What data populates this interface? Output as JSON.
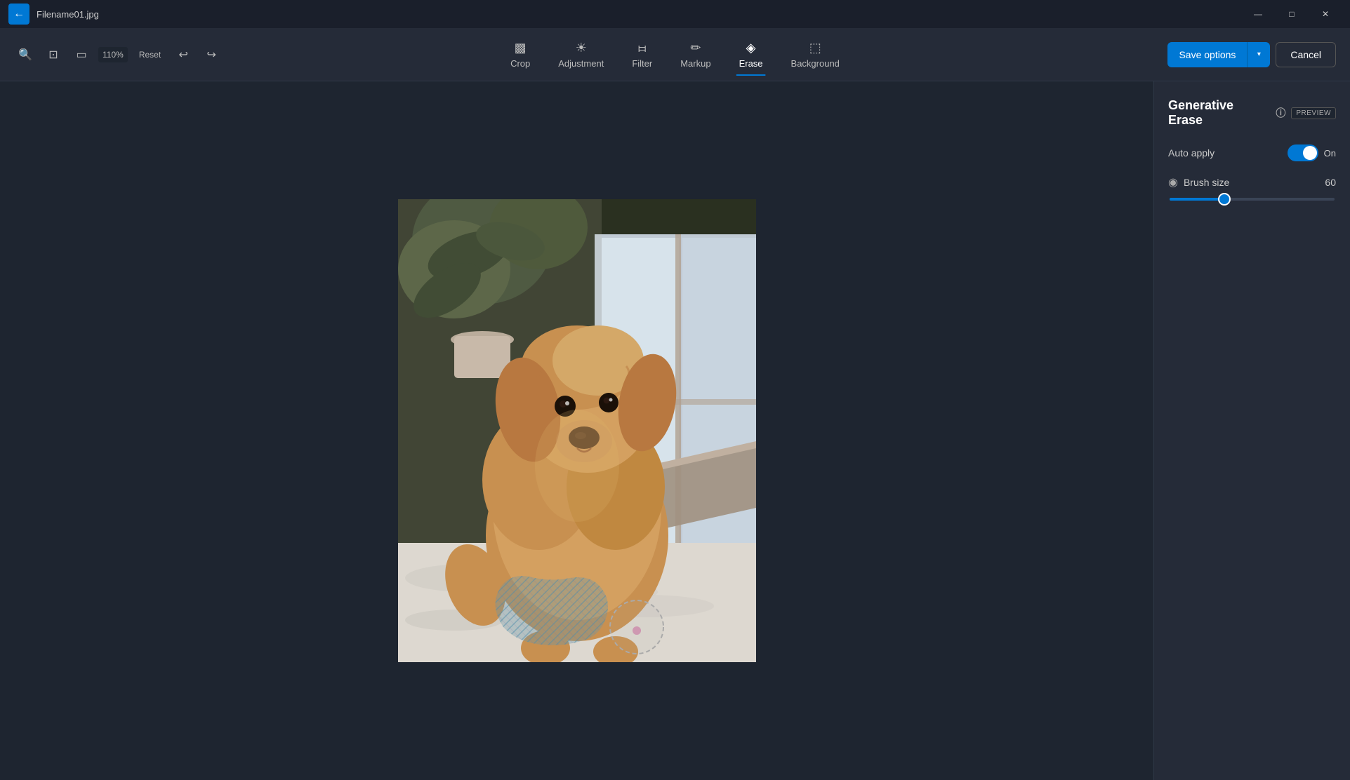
{
  "titlebar": {
    "filename": "Filename01.jpg",
    "minimize_label": "—",
    "maximize_label": "□",
    "close_label": "✕"
  },
  "toolbar": {
    "zoom_level": "110%",
    "reset_label": "Reset",
    "undo_icon": "↩",
    "redo_icon": "↪",
    "tools": [
      {
        "id": "crop",
        "label": "Crop",
        "icon": "⊡",
        "active": false
      },
      {
        "id": "adjustment",
        "label": "Adjustment",
        "icon": "☀",
        "active": false
      },
      {
        "id": "filter",
        "label": "Filter",
        "icon": "⧖",
        "active": false
      },
      {
        "id": "markup",
        "label": "Markup",
        "icon": "✏",
        "active": false
      },
      {
        "id": "erase",
        "label": "Erase",
        "icon": "◈",
        "active": true
      },
      {
        "id": "background",
        "label": "Background",
        "icon": "⬚",
        "active": false
      }
    ],
    "save_options_label": "Save options",
    "cancel_label": "Cancel"
  },
  "panel": {
    "title": "Generative Erase",
    "preview_badge": "PREVIEW",
    "info_tooltip": "Information",
    "auto_apply_label": "Auto apply",
    "toggle_state": "On",
    "brush_size_label": "Brush size",
    "brush_size_value": "60",
    "slider_percent": 33
  }
}
